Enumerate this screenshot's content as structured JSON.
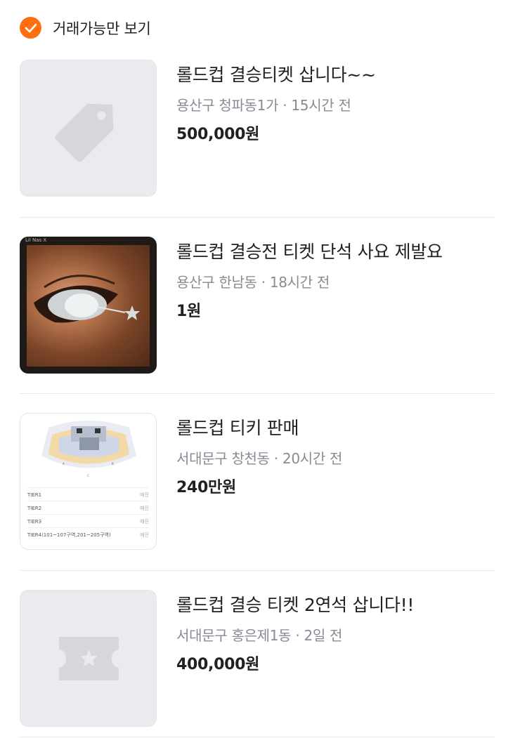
{
  "filter": {
    "label": "거래가능만 보기",
    "checked": true,
    "accent": "#ff6f0f"
  },
  "items": [
    {
      "title": "롤드컵 결승티켓 삽니다~~",
      "meta": "용산구 청파동1가 · 15시간 전",
      "price": "500,000원",
      "thumb": "tag-icon"
    },
    {
      "title": "롤드컵 결승전 티켓 단석 사요 제발요",
      "meta": "용산구 한남동 · 18시간 전",
      "price": "1원",
      "thumb": "photo",
      "photo_caption": "Lil Nas X"
    },
    {
      "title": "롤드컵 티키 판매",
      "meta": "서대문구 창천동 · 20시간 전",
      "price": "240만원",
      "thumb": "seat-chart",
      "seat_rows": [
        {
          "name": "TIER1",
          "note": "매진"
        },
        {
          "name": "TIER2",
          "note": "매진"
        },
        {
          "name": "TIER3",
          "note": "매진"
        },
        {
          "name": "TIER4(101~107구역,201~205구역)",
          "note": "매진"
        }
      ]
    },
    {
      "title": "롤드컵 결승 티켓 2연석 삽니다!!",
      "meta": "서대문구 홍은제1동 · 2일 전",
      "price": "400,000원",
      "thumb": "ticket-icon"
    }
  ]
}
